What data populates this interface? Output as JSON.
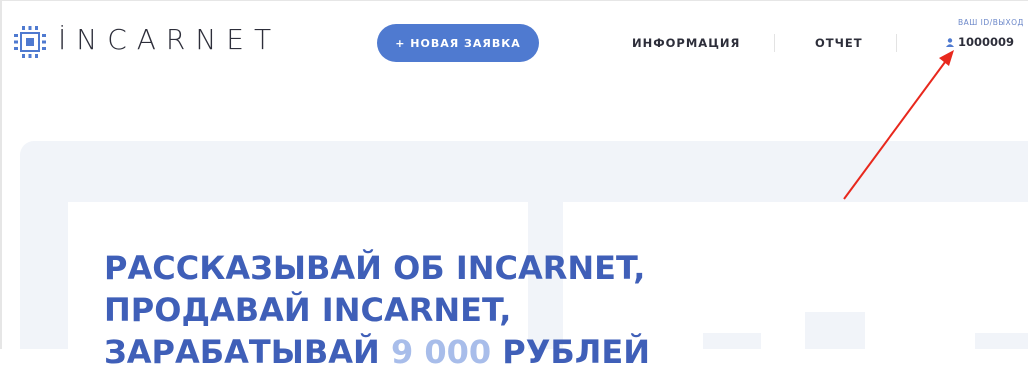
{
  "header": {
    "logo_text": "İNCARNET",
    "new_request_button": "+ НОВАЯ ЗАЯВКА",
    "nav": [
      "ИНФОРМАЦИЯ",
      "ОТЧЕТ"
    ],
    "id_caption": "ВАШ ID/ВЫХОД",
    "user_id": "1000009"
  },
  "hero": {
    "line1": "РАССКАЗЫВАЙ ОБ INCARNET,",
    "line2": "ПРОДАВАЙ INCARNET,",
    "line3_prefix": "ЗАРАБАТЫВАЙ ",
    "line3_amount": "9 000",
    "line3_suffix": " РУБЛЕЙ"
  },
  "colors": {
    "accent": "#4f7ad0",
    "title": "#3f5fb8",
    "arrow": "#e8281d",
    "hero_bg": "#f1f4f9"
  },
  "icons": [
    "chip-logo-icon",
    "user-icon"
  ]
}
